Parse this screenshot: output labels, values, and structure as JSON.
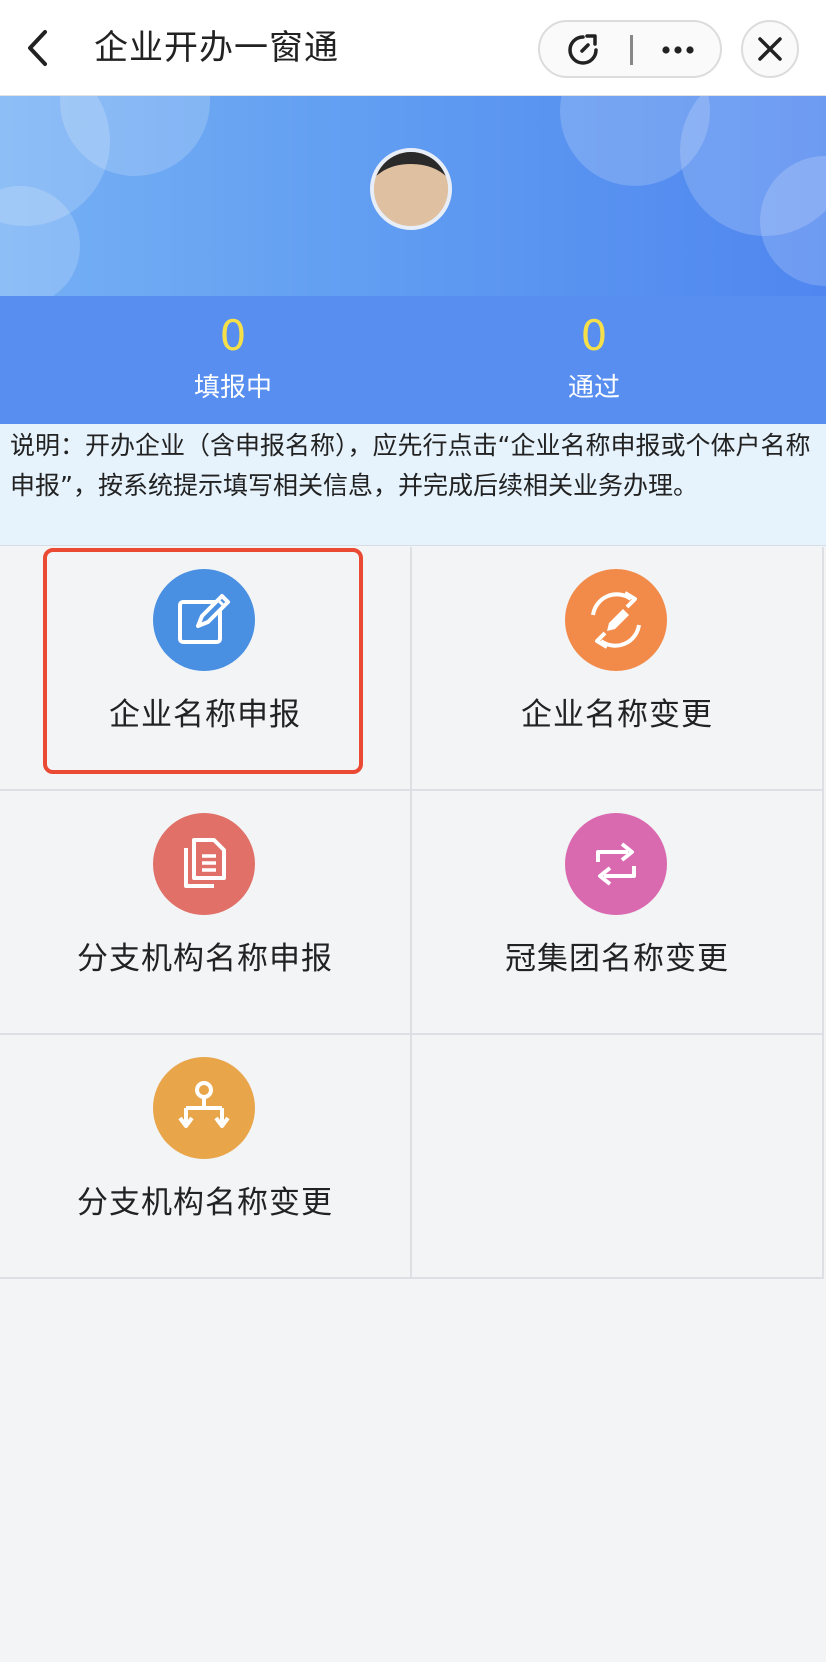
{
  "nav": {
    "title": "企业开办一窗通",
    "icons": [
      "chevron-left-icon",
      "refresh-icon",
      "more-icon",
      "close-icon"
    ]
  },
  "stats": [
    {
      "value": "0",
      "label": "填报中"
    },
    {
      "value": "0",
      "label": "通过"
    }
  ],
  "notice": {
    "text": "说明：开办企业（含申报名称），应先行点击“企业名称申报或个体户名称申报”，按系统提示填写相关信息，并完成后续相关业务办理。"
  },
  "services": [
    {
      "label": "企业名称申报",
      "icon": "edit-icon",
      "color": "#4a90e2"
    },
    {
      "label": "企业名称变更",
      "icon": "change-icon",
      "color": "#f28b4a"
    },
    {
      "label": "分支机构名称申报",
      "icon": "document-icon",
      "color": "#e07068"
    },
    {
      "label": "冠集团名称变更",
      "icon": "transfer-icon",
      "color": "#d96ab0"
    },
    {
      "label": "分支机构名称变更",
      "icon": "branch-icon",
      "color": "#e8a54a"
    }
  ],
  "colors": {
    "banner": "#5f9bf1",
    "stat_value": "#f6e04a",
    "notice_bg": "#e6f3fc",
    "highlight": "#ea4a34"
  }
}
